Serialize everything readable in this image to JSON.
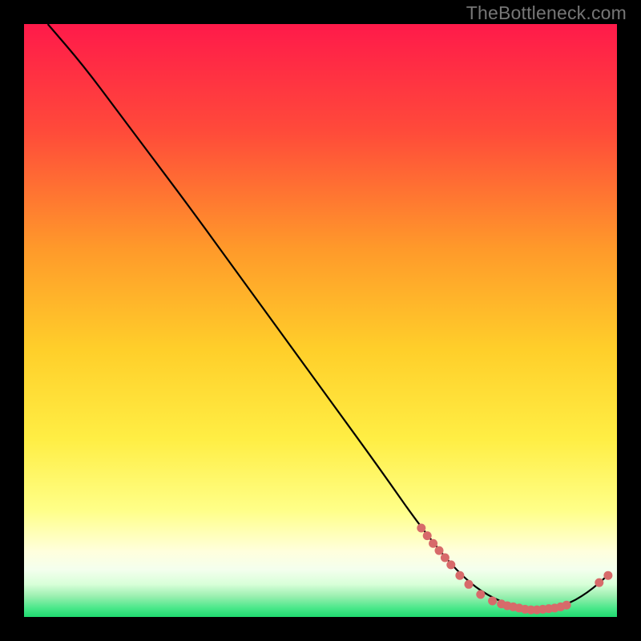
{
  "attribution": "TheBottleneck.com",
  "colors": {
    "background": "#000000",
    "gradient_top": "#ff1a4a",
    "gradient_mid1": "#ff7a2a",
    "gradient_mid2": "#ffd933",
    "gradient_yellow": "#ffff66",
    "gradient_light": "#ffffcc",
    "gradient_green": "#2ee87a",
    "line": "#000000",
    "dot": "#d76a6a"
  },
  "chart_data": {
    "type": "line",
    "title": "",
    "xlabel": "",
    "ylabel": "",
    "xlim": [
      0,
      100
    ],
    "ylim": [
      0,
      100
    ],
    "line_points": [
      {
        "x": 4,
        "y": 100
      },
      {
        "x": 10,
        "y": 93
      },
      {
        "x": 16,
        "y": 85
      },
      {
        "x": 22,
        "y": 77
      },
      {
        "x": 28,
        "y": 69
      },
      {
        "x": 36,
        "y": 58
      },
      {
        "x": 44,
        "y": 47
      },
      {
        "x": 52,
        "y": 36
      },
      {
        "x": 60,
        "y": 25
      },
      {
        "x": 67,
        "y": 15
      },
      {
        "x": 74,
        "y": 6.5
      },
      {
        "x": 80,
        "y": 2.5
      },
      {
        "x": 86,
        "y": 1.2
      },
      {
        "x": 91,
        "y": 1.8
      },
      {
        "x": 95,
        "y": 4
      },
      {
        "x": 99,
        "y": 7.5
      }
    ],
    "dots": [
      {
        "x": 67,
        "y": 15
      },
      {
        "x": 68,
        "y": 13.7
      },
      {
        "x": 69,
        "y": 12.4
      },
      {
        "x": 70,
        "y": 11.2
      },
      {
        "x": 71,
        "y": 10
      },
      {
        "x": 72,
        "y": 8.8
      },
      {
        "x": 73.5,
        "y": 7
      },
      {
        "x": 75,
        "y": 5.5
      },
      {
        "x": 77,
        "y": 3.8
      },
      {
        "x": 79,
        "y": 2.7
      },
      {
        "x": 80.5,
        "y": 2.2
      },
      {
        "x": 81.5,
        "y": 1.9
      },
      {
        "x": 82.5,
        "y": 1.7
      },
      {
        "x": 83.5,
        "y": 1.5
      },
      {
        "x": 84.5,
        "y": 1.3
      },
      {
        "x": 85.5,
        "y": 1.2
      },
      {
        "x": 86.5,
        "y": 1.2
      },
      {
        "x": 87.5,
        "y": 1.3
      },
      {
        "x": 88.5,
        "y": 1.4
      },
      {
        "x": 89.5,
        "y": 1.5
      },
      {
        "x": 90.5,
        "y": 1.7
      },
      {
        "x": 91.5,
        "y": 2
      },
      {
        "x": 97,
        "y": 5.8
      },
      {
        "x": 98.5,
        "y": 7
      }
    ]
  }
}
